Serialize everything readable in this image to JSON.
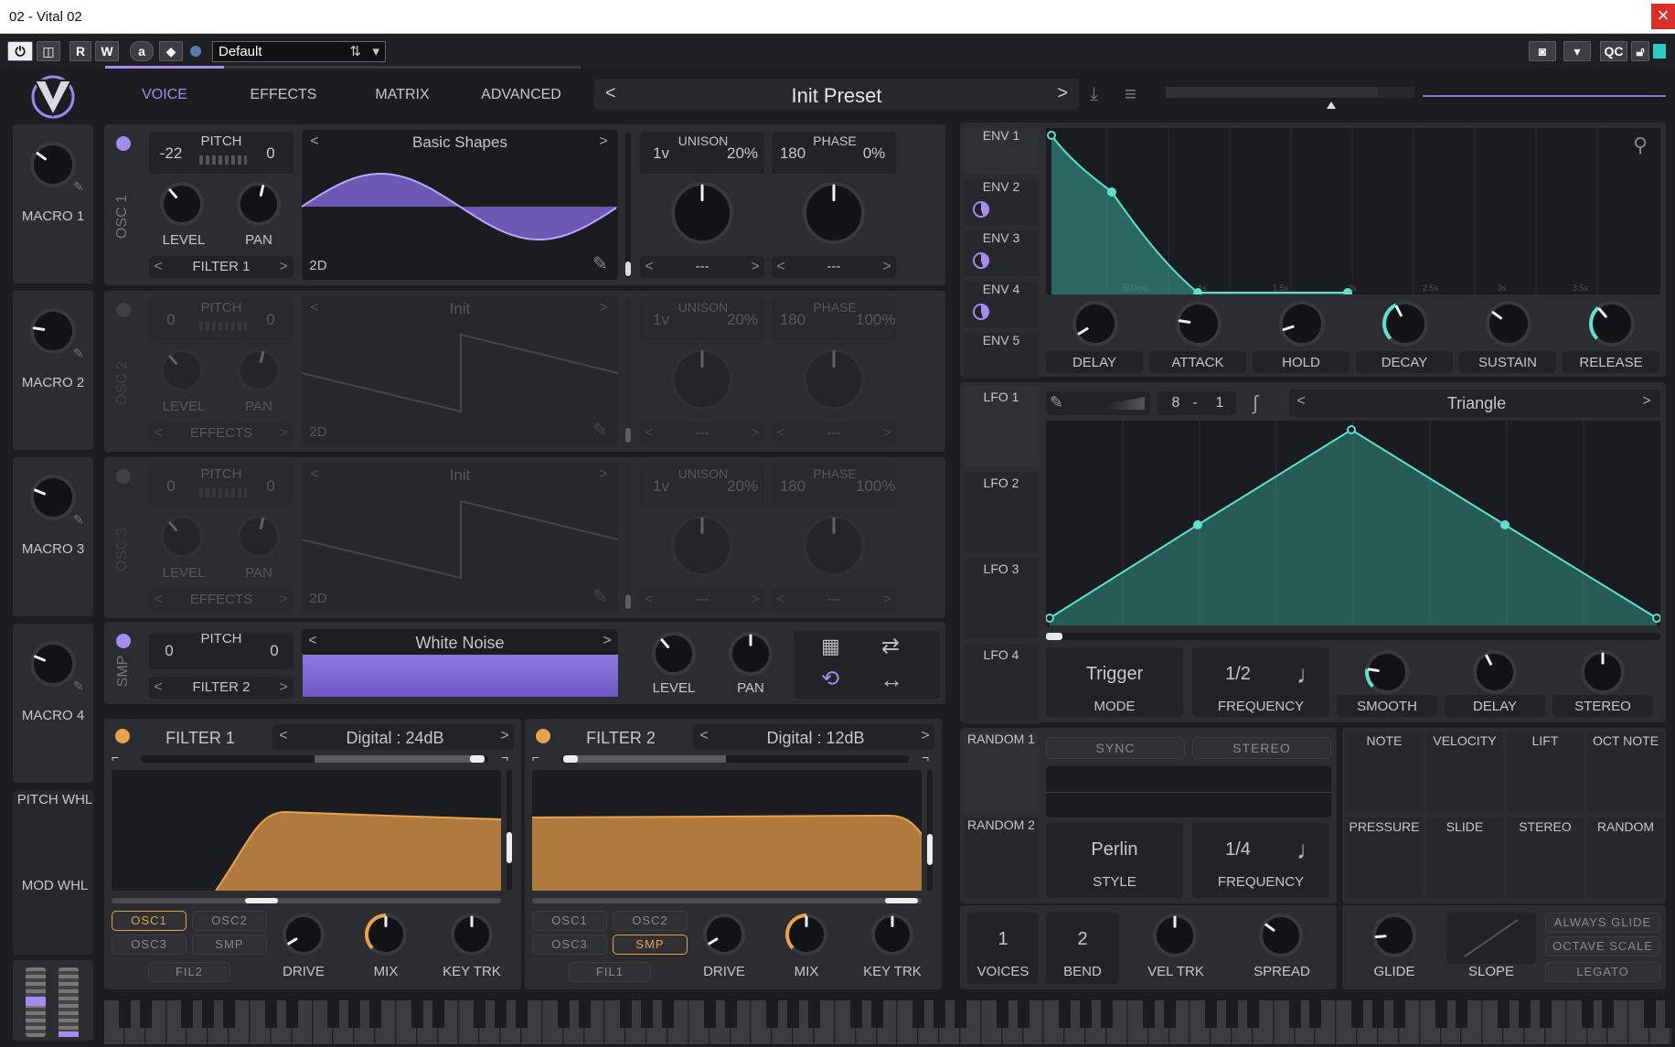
{
  "window": {
    "title": "02 - Vital 02",
    "close_glyph": "×"
  },
  "host": {
    "preset": "Default",
    "buttons": [
      "R",
      "W",
      "a",
      "QC"
    ]
  },
  "tabs": [
    "VOICE",
    "EFFECTS",
    "MATRIX",
    "ADVANCED"
  ],
  "preset": {
    "name": "Init Preset",
    "prev": "<",
    "next": ">"
  },
  "macros": [
    {
      "label": "MACRO 1",
      "value": 0.3
    },
    {
      "label": "MACRO 2",
      "value": 0.2
    },
    {
      "label": "MACRO 3",
      "value": 0.25
    },
    {
      "label": "MACRO 4",
      "value": 0.25
    }
  ],
  "wheels": {
    "pitch": "PITCH WHL",
    "mod": "MOD WHL"
  },
  "osc1": {
    "name": "OSC 1",
    "pitch_label": "PITCH",
    "pitch_left": "-22",
    "pitch_right": "0",
    "level": "LEVEL",
    "pan": "PAN",
    "route": "FILTER 1",
    "wavetable": "Basic Shapes",
    "dim": "2D",
    "unison_label": "UNISON",
    "unison_voices": "1v",
    "unison_detune": "20%",
    "phase_label": "PHASE",
    "phase_value": "180",
    "phase_pct": "0%",
    "unison_sel": "---",
    "phase_sel": "---"
  },
  "osc2": {
    "name": "OSC 2",
    "pitch_label": "PITCH",
    "pitch_left": "0",
    "pitch_right": "0",
    "level": "LEVEL",
    "pan": "PAN",
    "route": "EFFECTS",
    "wavetable": "Init",
    "dim": "2D",
    "unison_label": "UNISON",
    "unison_voices": "1v",
    "unison_detune": "20%",
    "phase_label": "PHASE",
    "phase_value": "180",
    "phase_pct": "100%",
    "unison_sel": "---",
    "phase_sel": "---"
  },
  "osc3": {
    "name": "OSC 3",
    "pitch_label": "PITCH",
    "pitch_left": "0",
    "pitch_right": "0",
    "level": "LEVEL",
    "pan": "PAN",
    "route": "EFFECTS",
    "wavetable": "Init",
    "dim": "2D",
    "unison_label": "UNISON",
    "unison_voices": "1v",
    "unison_detune": "20%",
    "phase_label": "PHASE",
    "phase_value": "180",
    "phase_pct": "100%",
    "unison_sel": "---",
    "phase_sel": "---"
  },
  "smp": {
    "name": "SMP",
    "pitch_label": "PITCH",
    "pitch_left": "0",
    "pitch_right": "0",
    "route": "FILTER 2",
    "sample": "White Noise",
    "level": "LEVEL",
    "pan": "PAN"
  },
  "filter1": {
    "name": "FILTER 1",
    "type": "Digital : 24dB",
    "chips": [
      "OSC1",
      "OSC2",
      "OSC3",
      "SMP"
    ],
    "active_chip": "OSC1",
    "link": "FIL2",
    "drive": "DRIVE",
    "mix": "MIX",
    "keytrk": "KEY TRK"
  },
  "filter2": {
    "name": "FILTER 2",
    "type": "Digital : 12dB",
    "chips": [
      "OSC1",
      "OSC2",
      "OSC3",
      "SMP"
    ],
    "active_chip": "SMP",
    "link": "FIL1",
    "drive": "DRIVE",
    "mix": "MIX",
    "keytrk": "KEY TRK"
  },
  "env_tabs": [
    "ENV 1",
    "ENV 2",
    "ENV 3",
    "ENV 4",
    "ENV 5"
  ],
  "env_knobs": [
    "DELAY",
    "ATTACK",
    "HOLD",
    "DECAY",
    "SUSTAIN",
    "RELEASE"
  ],
  "env_times": [
    "600ms",
    "1s",
    "1.5s",
    "2s",
    "2.5s",
    "3s",
    "3.5s"
  ],
  "lfo_tabs": [
    "LFO 1",
    "LFO 2",
    "LFO 3",
    "LFO 4"
  ],
  "lfo": {
    "tempo_num": "8",
    "tempo_sep": "-",
    "tempo_den": "1",
    "shape": "Triangle",
    "mode": "Trigger",
    "mode_label": "MODE",
    "frequency": "1/2",
    "frequency_label": "FREQUENCY",
    "knobs": [
      "SMOOTH",
      "DELAY",
      "STEREO"
    ]
  },
  "random_tabs": [
    "RANDOM 1",
    "RANDOM 2"
  ],
  "random": {
    "sync": "SYNC",
    "stereo": "STEREO",
    "style": "Perlin",
    "style_label": "STYLE",
    "frequency": "1/4",
    "frequency_label": "FREQUENCY"
  },
  "mod_sources": [
    "NOTE",
    "VELOCITY",
    "LIFT",
    "OCT NOTE",
    "PRESSURE",
    "SLIDE",
    "STEREO",
    "RANDOM"
  ],
  "voice": {
    "voices": "1",
    "voices_label": "VOICES",
    "bend": "2",
    "bend_label": "BEND",
    "veltrk": "VEL TRK",
    "spread": "SPREAD"
  },
  "glide": {
    "glide": "GLIDE",
    "slope": "SLOPE",
    "options": [
      "ALWAYS GLIDE",
      "OCTAVE SCALE",
      "LEGATO"
    ]
  },
  "colors": {
    "accent": "#a48cf0",
    "env": "#5ee0cf",
    "filter": "#e8a24c",
    "bg": "#1c1d20",
    "panel": "#2b2d31"
  }
}
